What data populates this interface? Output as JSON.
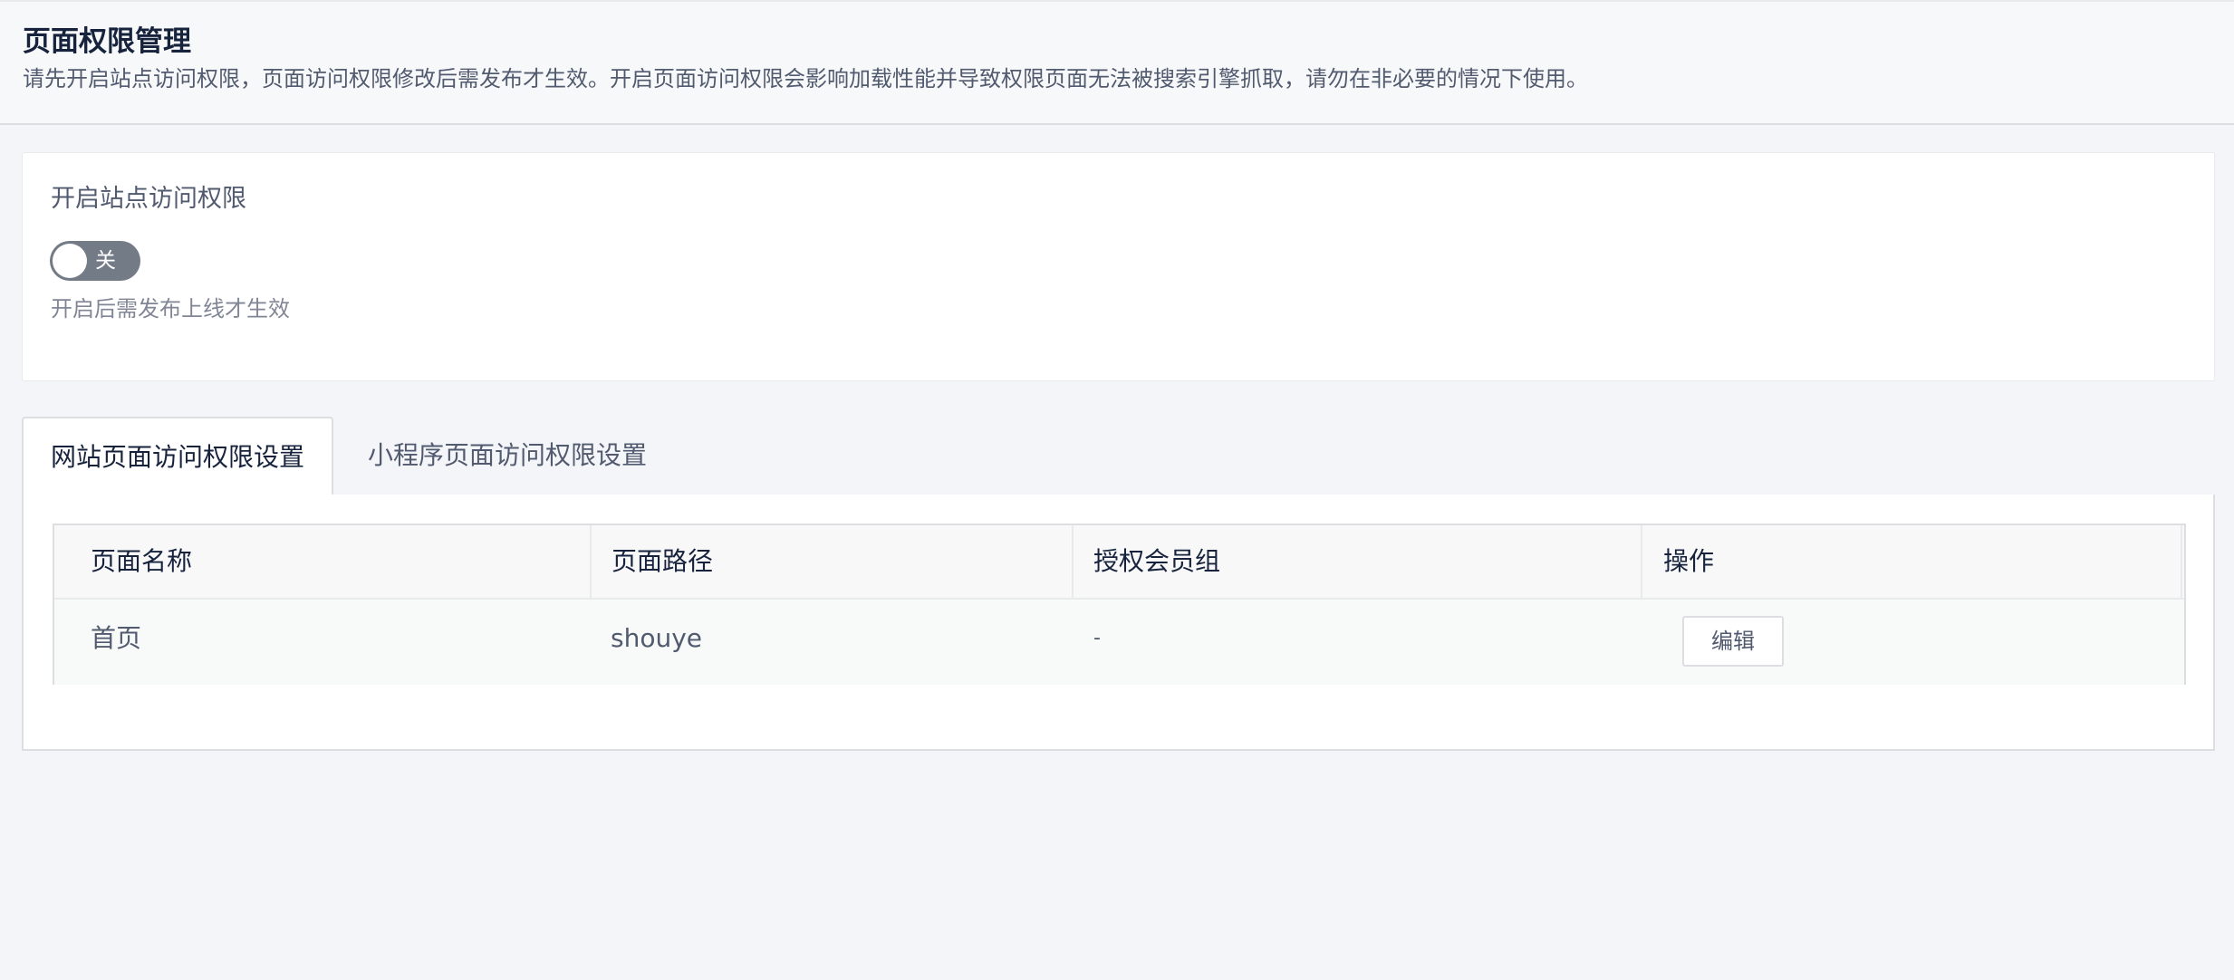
{
  "header": {
    "title": "页面权限管理",
    "description": "请先开启站点访问权限，页面访问权限修改后需发布才生效。开启页面访问权限会影响加载性能并导致权限页面无法被搜索引擎抓取，请勿在非必要的情况下使用。"
  },
  "site_access": {
    "title": "开启站点访问权限",
    "switch_label": "关",
    "switch_on": false,
    "hint": "开启后需发布上线才生效"
  },
  "tabs": [
    {
      "label": "网站页面访问权限设置",
      "active": true
    },
    {
      "label": "小程序页面访问权限设置",
      "active": false
    }
  ],
  "table": {
    "columns": [
      "页面名称",
      "页面路径",
      "授权会员组",
      "操作"
    ],
    "rows": [
      {
        "name": "首页",
        "path": "shouye",
        "group": "-",
        "action": "编辑"
      }
    ]
  }
}
